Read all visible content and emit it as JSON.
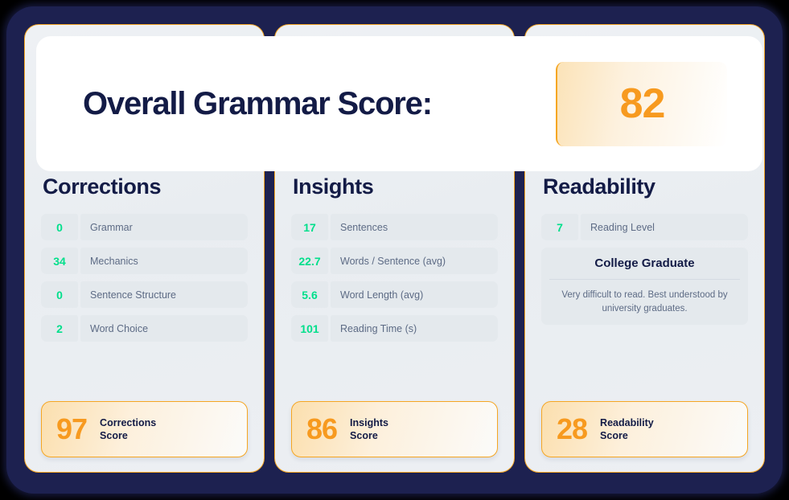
{
  "header": {
    "title": "Overall Grammar Score:",
    "badge_value": "82"
  },
  "accent_colors": {
    "orange": "#f79a1f",
    "border_orange": "#f5a623",
    "navy": "#131b46",
    "frame_navy": "#1d2150",
    "green": "#00df8b",
    "label_gray": "#5d6b85",
    "row_bg": "#e4e9ed",
    "card_bg": "#eceff3"
  },
  "cards": [
    {
      "title": "Corrections",
      "rows": [
        {
          "value": "0",
          "label": "Grammar"
        },
        {
          "value": "34",
          "label": "Mechanics"
        },
        {
          "value": "0",
          "label": "Sentence Structure"
        },
        {
          "value": "2",
          "label": "Word Choice"
        }
      ],
      "score": {
        "value": "97",
        "label_line1": "Corrections",
        "label_line2": "Score"
      }
    },
    {
      "title": "Insights",
      "rows": [
        {
          "value": "17",
          "label": "Sentences"
        },
        {
          "value": "22.7",
          "label": "Words / Sentence (avg)"
        },
        {
          "value": "5.6",
          "label": "Word Length (avg)"
        },
        {
          "value": "101",
          "label": "Reading Time (s)"
        }
      ],
      "score": {
        "value": "86",
        "label_line1": "Insights",
        "label_line2": "Score"
      }
    },
    {
      "title": "Readability",
      "rows": [
        {
          "value": "7",
          "label": "Reading Level"
        }
      ],
      "level": {
        "name": "College Graduate",
        "description": "Very difficult to read. Best understood by university graduates."
      },
      "score": {
        "value": "28",
        "label_line1": "Readability",
        "label_line2": "Score"
      }
    }
  ]
}
